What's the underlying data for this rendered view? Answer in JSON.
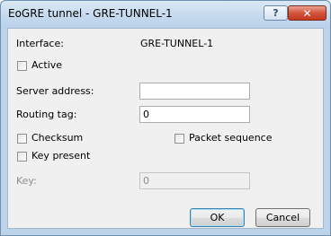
{
  "window": {
    "title": "EoGRE tunnel - GRE-TUNNEL-1",
    "help_glyph": "?",
    "close_glyph": "✕"
  },
  "form": {
    "interface_label": "Interface:",
    "interface_value": "GRE-TUNNEL-1",
    "active_label": "Active",
    "active_checked": false,
    "server_address_label": "Server address:",
    "server_address_value": "",
    "routing_tag_label": "Routing tag:",
    "routing_tag_value": "0",
    "checksum_label": "Checksum",
    "checksum_checked": false,
    "packet_sequence_label": "Packet sequence",
    "packet_sequence_checked": false,
    "key_present_label": "Key present",
    "key_present_checked": false,
    "key_label": "Key:",
    "key_value": "0"
  },
  "buttons": {
    "ok_label": "OK",
    "cancel_label": "Cancel"
  }
}
